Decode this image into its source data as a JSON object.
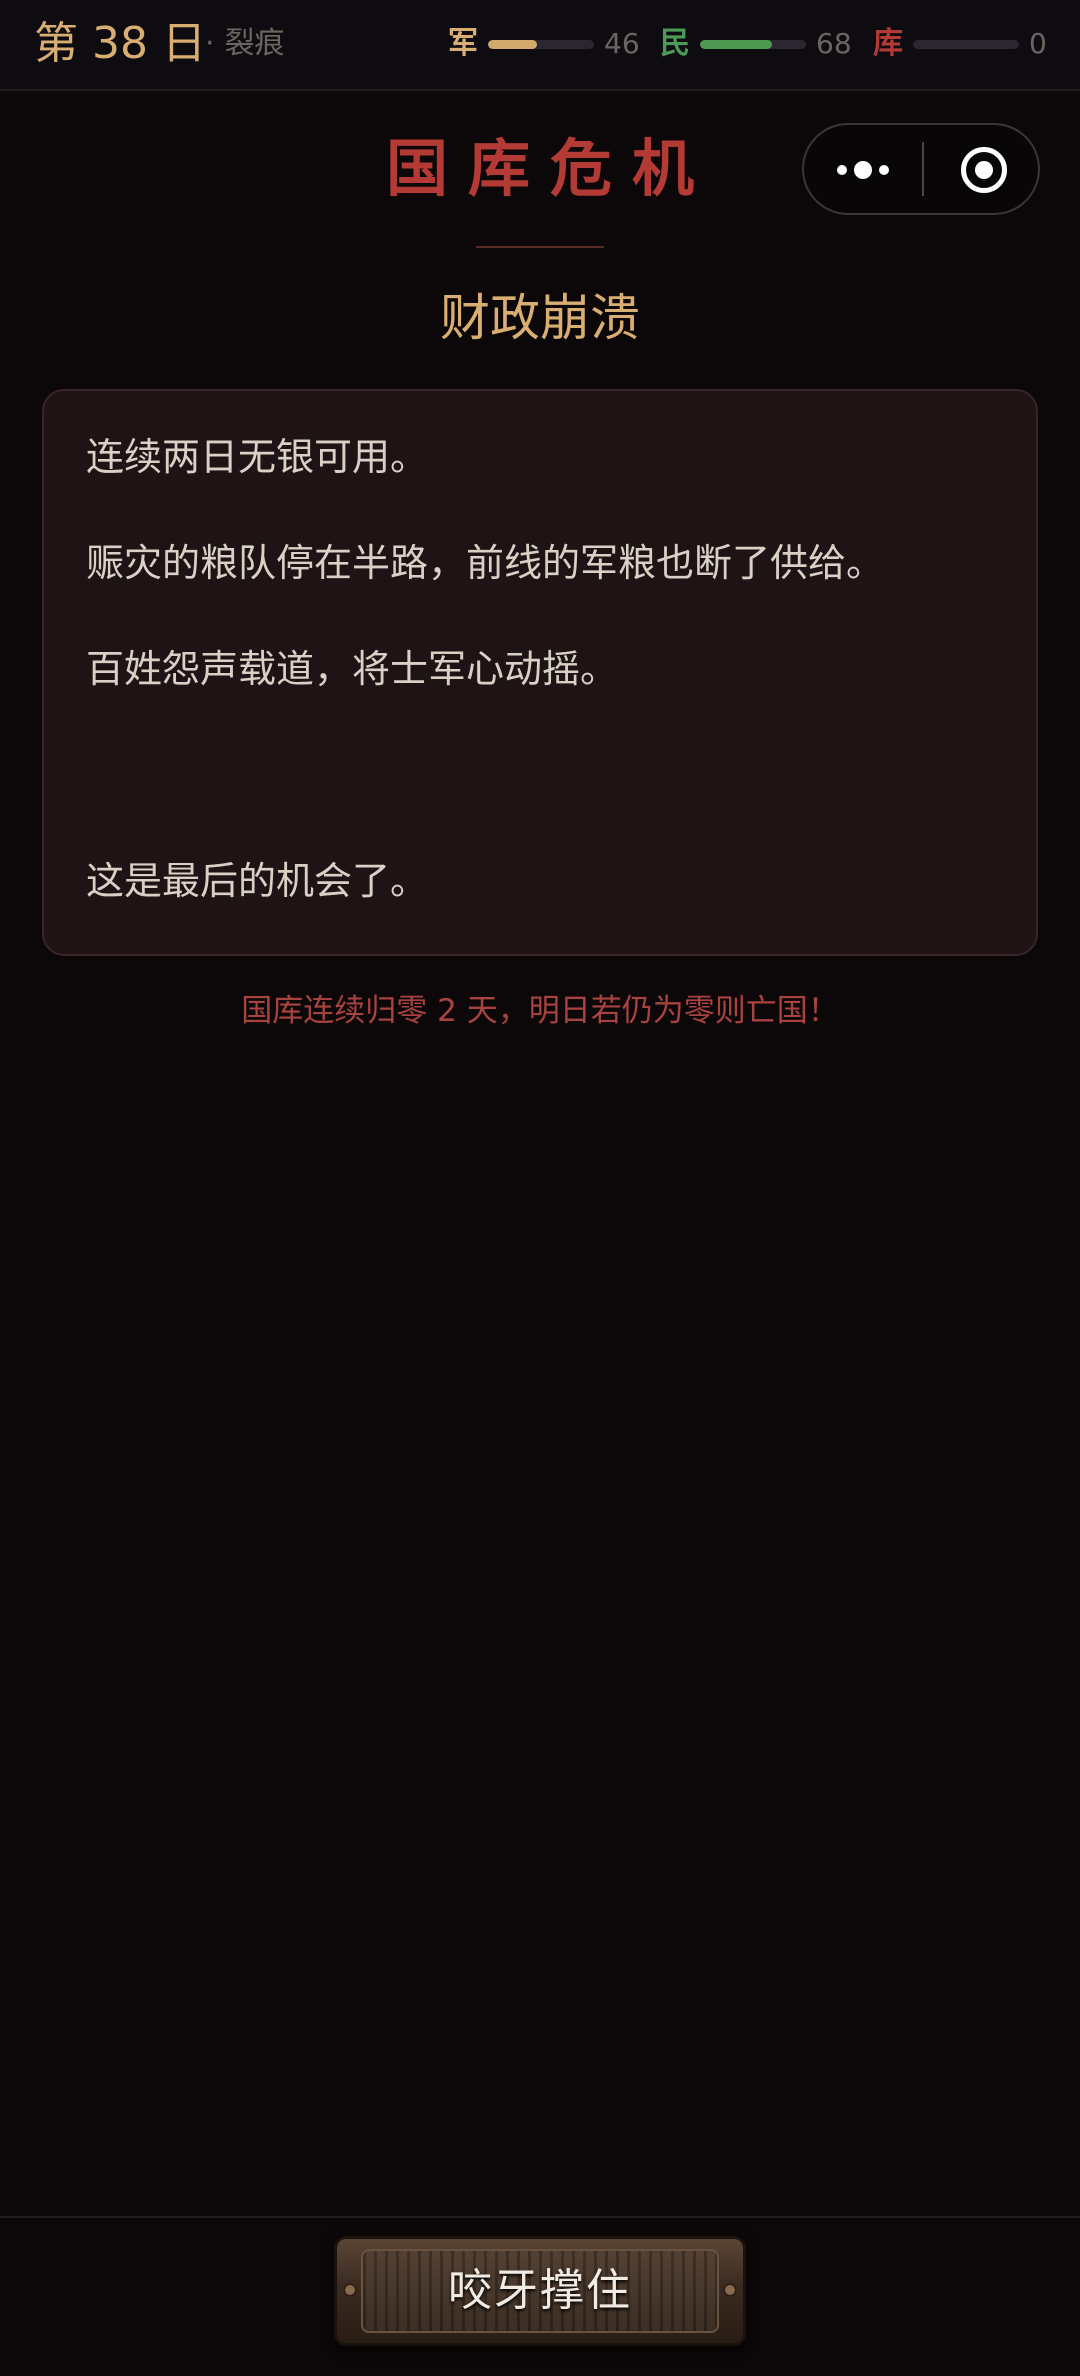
{
  "header": {
    "day_label": "第 38 日",
    "phase_label": "裂痕",
    "separator": "·"
  },
  "stats": [
    {
      "label": "军",
      "value": "46",
      "level": 0.46,
      "label_color": "#d8ae72",
      "fill_color": "#d2aa6c"
    },
    {
      "label": "民",
      "value": "68",
      "level": 0.68,
      "label_color": "#4c9a55",
      "fill_color": "#4e9a52"
    },
    {
      "label": "库",
      "value": "0",
      "level": 0.0,
      "label_color": "#b33a35",
      "fill_color": "#b33a35"
    }
  ],
  "capsule": {
    "more_icon": "more-dots-icon",
    "close_icon": "target-circle-icon"
  },
  "event": {
    "title": "国库危机",
    "subtitle": "财政崩溃",
    "paragraphs": [
      "连续两日无银可用。",
      "赈灾的粮队停在半路，前线的军粮也断了供给。",
      "百姓怨声载道，将士军心动摇。",
      "这是最后的机会了。"
    ],
    "warning": "国库连续归零 2 天，明日若仍为零则亡国！"
  },
  "action": {
    "label": "咬牙撑住"
  },
  "colors": {
    "background": "#0c0708",
    "gold": "#d8ae72",
    "crimson": "#b33a35",
    "card": "#1e1415"
  }
}
